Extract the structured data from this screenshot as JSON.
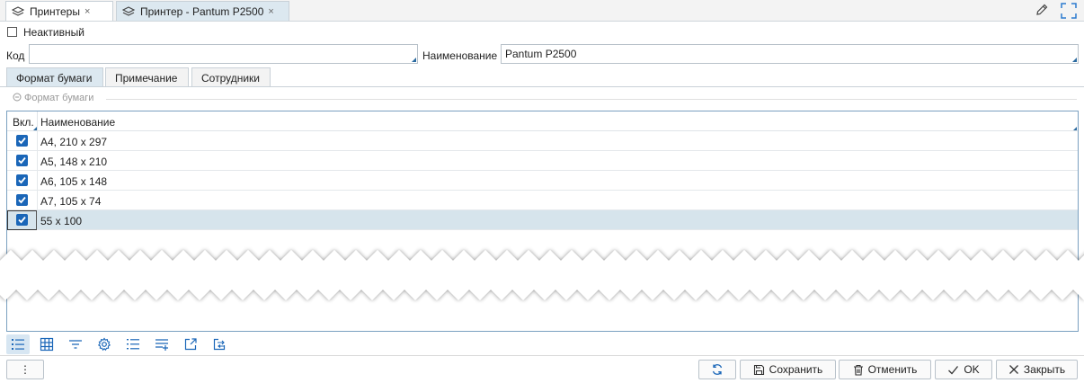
{
  "tabs": [
    {
      "label": "Принтеры",
      "close": "×",
      "icon": "layers-icon"
    },
    {
      "label": "Принтер - Pantum P2500",
      "close": "×",
      "icon": "layers-icon"
    }
  ],
  "header_icons": [
    "edit-pencil-icon",
    "fullscreen-icon"
  ],
  "form": {
    "inactive_label": "Неактивный",
    "inactive_checked": false,
    "code_label": "Код",
    "code_value": "",
    "name_label": "Наименование",
    "name_value": "Pantum P2500"
  },
  "subtabs": [
    {
      "label": "Формат бумаги",
      "active": true
    },
    {
      "label": "Примечание",
      "active": false
    },
    {
      "label": "Сотрудники",
      "active": false
    }
  ],
  "group": {
    "label": "Формат бумаги",
    "icon": "collapse-circle-icon"
  },
  "table": {
    "columns": [
      "Вкл.",
      "Наименование"
    ],
    "rows": [
      {
        "enabled": true,
        "name": "A4, 210 x 297"
      },
      {
        "enabled": true,
        "name": "A5, 148 x 210"
      },
      {
        "enabled": true,
        "name": "A6, 105 x 148"
      },
      {
        "enabled": true,
        "name": "A7, 105 x 74"
      },
      {
        "enabled": true,
        "name": "55 x 100",
        "selected": true
      }
    ]
  },
  "grid_toolbar": [
    "list-view-icon",
    "table-view-icon",
    "filter-icon",
    "settings-gear-icon",
    "numbered-list-icon",
    "add-row-icon",
    "export-icon",
    "transfer-icon"
  ],
  "footer": {
    "more_label": "⋮",
    "refresh_icon": "refresh-icon",
    "save_label": "Сохранить",
    "cancel_label": "Отменить",
    "ok_label": "OK",
    "close_label": "Закрыть"
  },
  "colors": {
    "accent": "#1a66b8",
    "selection": "#d6e4ec",
    "active_tab": "#dce8f0"
  }
}
